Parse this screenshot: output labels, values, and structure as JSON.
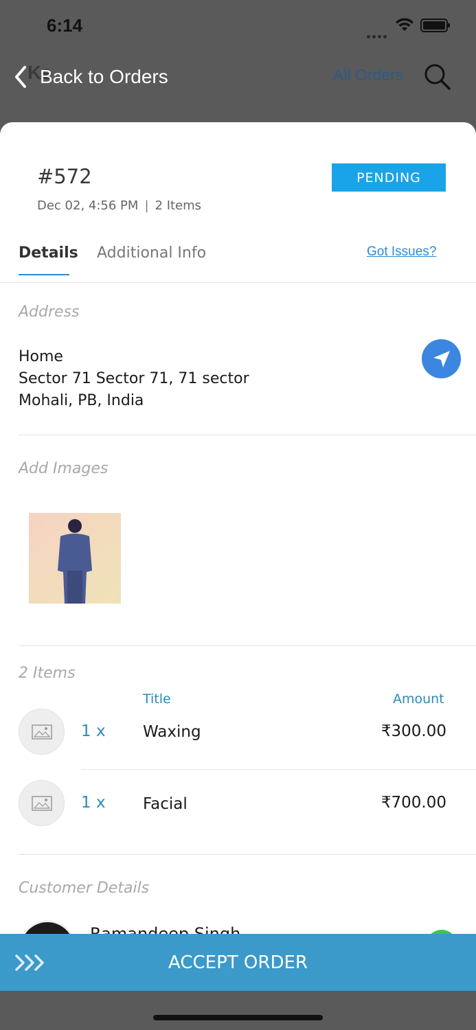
{
  "status_bar": {
    "time": "6:14"
  },
  "nav": {
    "back_label": "Back to Orders",
    "back_ghost": "Ke",
    "right_link": "All Orders"
  },
  "order": {
    "id": "#572",
    "date": "Dec 02, 4:56 PM",
    "separator": "|",
    "item_count": "2 Items",
    "status": "PENDING"
  },
  "tabs": [
    {
      "label": "Details",
      "active": true
    },
    {
      "label": "Additional Info",
      "active": false
    }
  ],
  "issues_link": "Got Issues?",
  "address": {
    "section_label": "Address",
    "line1": "Home",
    "line2": "Sector 71 Sector 71, 71 sector",
    "line3": "Mohali, PB, India"
  },
  "images": {
    "section_label": "Add Images"
  },
  "items": {
    "section_label": "2 Items",
    "col_title": "Title",
    "col_amount": "Amount",
    "rows": [
      {
        "qty": "1 x",
        "title": "Waxing",
        "amount": "₹300.00"
      },
      {
        "qty": "1 x",
        "title": "Facial",
        "amount": "₹700.00"
      }
    ]
  },
  "customer": {
    "section_label": "Customer Details",
    "name": "Ramandeep Singh"
  },
  "accept_button": "ACCEPT ORDER",
  "colors": {
    "status_badge": "#1aa3e8",
    "accent": "#2a8ab8",
    "accept_bar": "#3b9ac9",
    "nav_button": "#3b86e0"
  }
}
